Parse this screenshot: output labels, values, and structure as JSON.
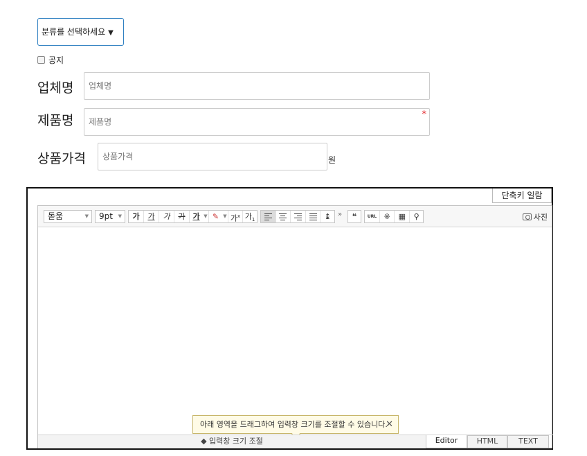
{
  "category": {
    "label": "분류를 선택하세요",
    "arrow": "▼"
  },
  "notice": {
    "label": "공지"
  },
  "fields": {
    "company": {
      "label": "업체명",
      "placeholder": "업체명"
    },
    "product": {
      "label": "제품명",
      "placeholder": "제품명",
      "required": "*"
    },
    "price": {
      "label": "상품가격",
      "placeholder": "상품가격",
      "unit": "원"
    }
  },
  "editor": {
    "shortcut_label": "단축키 일람",
    "font_name": "돋움",
    "font_size": "9pt",
    "fmt": {
      "bold": "가",
      "underline": "가",
      "italic": "가",
      "strike": "가",
      "text_color": "가",
      "sup": "가",
      "sup_mark": "x",
      "sub": "가",
      "sub_mark": "1"
    },
    "more": "»",
    "quote": "❝",
    "url": "URL",
    "special_char": "※",
    "search": "⚲",
    "photo_label": "사진",
    "tooltip": "아래 영역을 드래그하여 입력창 크기를 조절할 수 있습니다.",
    "tooltip_close": "✕",
    "resize_label": "◆ 입력창 크기 조절",
    "modes": [
      "Editor",
      "HTML",
      "TEXT"
    ]
  }
}
